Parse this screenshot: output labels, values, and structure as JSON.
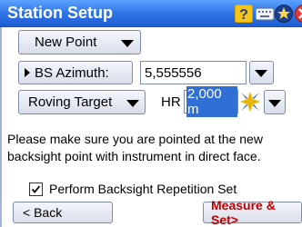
{
  "window": {
    "title": "Station Setup",
    "icons": [
      "help-icon",
      "keyboard-icon",
      "favorites-star-icon",
      "close-icon"
    ],
    "colors": {
      "titlebar": "#2f74e6",
      "measure_text": "#c00000",
      "selection": "#2f6fd6"
    }
  },
  "point_method": {
    "value": "New Point"
  },
  "backsight": {
    "mode_label": "BS Azimuth:",
    "azimuth_value": "5,555556"
  },
  "target": {
    "type_value": "Roving Target",
    "hr_label": "HR",
    "hr_value": "2,000 m"
  },
  "message": "Please make sure you are pointed at the new backsight point with instrument in direct face.",
  "options": {
    "repetition_label": "Perform Backsight Repetition Set",
    "repetition_checked": true
  },
  "footer": {
    "back_label": "< Back",
    "measure_label": "Measure & Set>"
  }
}
